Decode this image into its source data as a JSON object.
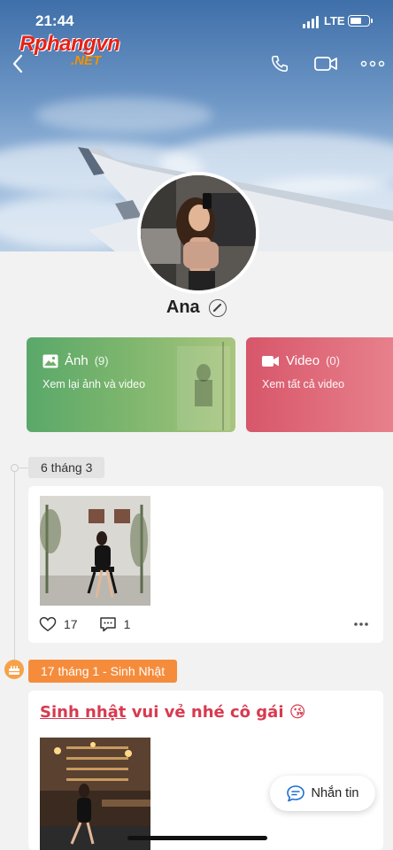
{
  "status_bar": {
    "time": "21:44",
    "network": "LTE"
  },
  "watermark": {
    "main": "Rphangvn",
    "sub": ".NET"
  },
  "profile": {
    "name": "Ana"
  },
  "cards": {
    "photos": {
      "title": "Ảnh",
      "count": "(9)",
      "subtitle": "Xem lại ảnh và video"
    },
    "videos": {
      "title": "Video",
      "count": "(0)",
      "subtitle": "Xem tất cả video"
    }
  },
  "timeline": [
    {
      "date": "6 tháng 3",
      "likes": "17",
      "comments": "1"
    },
    {
      "date": "17 tháng 1 - Sinh Nhật",
      "text_underlined": "Sinh nhật",
      "text_rest": " vui vẻ nhé cô gái 😘"
    }
  ],
  "message_button": {
    "label": "Nhắn tin"
  },
  "colors": {
    "photo_card": "#6fb06b",
    "video_card": "#e06f7e",
    "birthday": "#f58c3c",
    "birthday_text": "#d83a4f"
  }
}
